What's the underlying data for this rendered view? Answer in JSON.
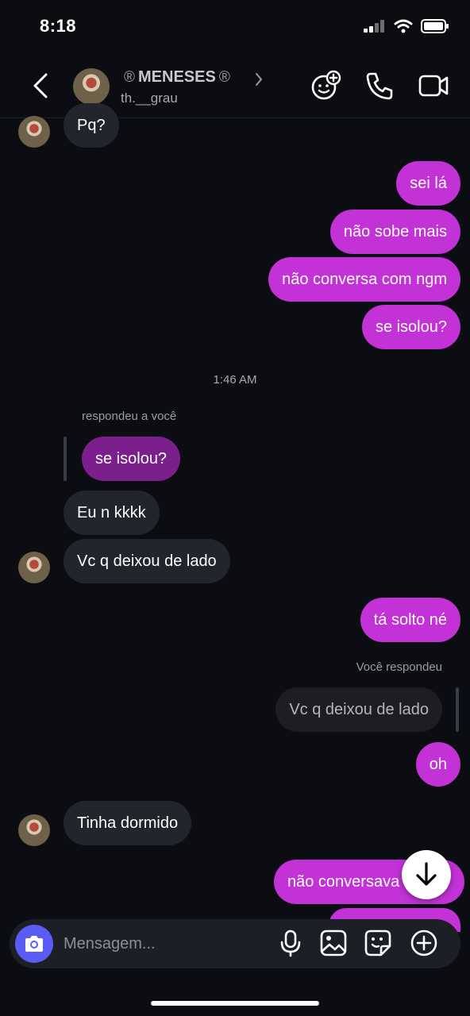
{
  "status_bar": {
    "time": "8:18"
  },
  "header": {
    "name": "MENESES",
    "reg_mark": "®",
    "username": "th.__grau",
    "icons": [
      "back-icon",
      "effects-icon",
      "phone-icon",
      "video-icon"
    ]
  },
  "messages": {
    "m1": "Pq?",
    "m2": "sei lá",
    "m3": "não sobe mais",
    "m4": "não conversa com ngm",
    "m5": "se isolou?",
    "timestamp": "1:46 AM",
    "reply_label_in": "respondeu a você",
    "reply_quote_in": "se isolou?",
    "m6": "Eu n kkkk",
    "m7": "Vc q deixou de lado",
    "m8": "tá solto né",
    "reply_label_out": "Você respondeu",
    "reply_quote_out": "Vc q deixou de lado",
    "m9": "oh",
    "m10": "Tinha dormido",
    "m11": "não conversava"
  },
  "composer": {
    "placeholder": "Mensagem...",
    "icons": [
      "camera-icon",
      "microphone-icon",
      "gallery-icon",
      "sticker-icon",
      "plus-icon"
    ]
  },
  "colors": {
    "outgoing": "#c232d6",
    "incoming": "#23252c",
    "camera": "#5b5cf5",
    "background": "#0b0d12"
  }
}
